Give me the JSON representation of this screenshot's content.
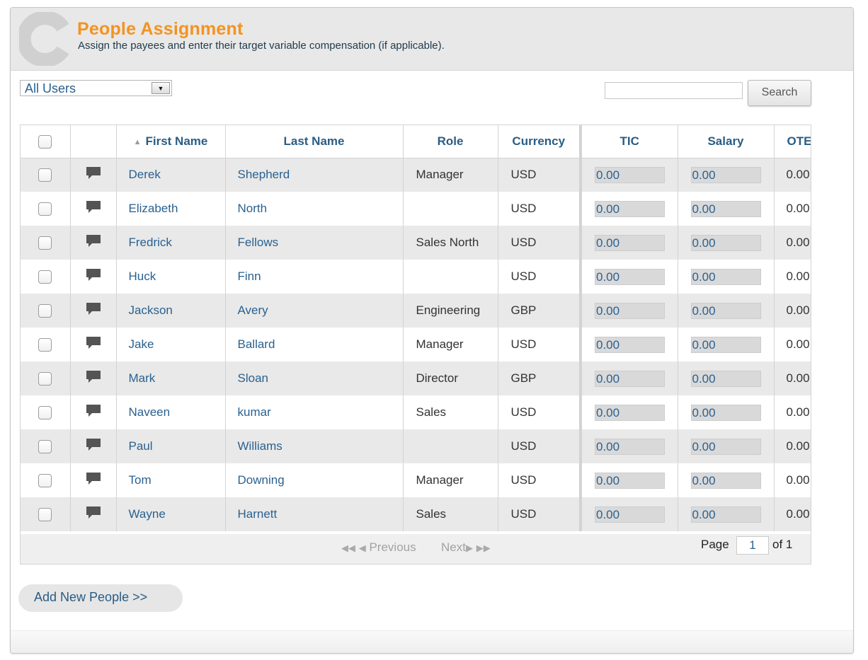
{
  "header": {
    "title": "People Assignment",
    "subtitle": "Assign the payees and enter their target variable compensation (if applicable)."
  },
  "filter": {
    "selected": "All Users"
  },
  "search": {
    "button_label": "Search",
    "value": ""
  },
  "table": {
    "columns": {
      "first_name": "First Name",
      "last_name": "Last Name",
      "role": "Role",
      "currency": "Currency",
      "tic": "TIC",
      "salary": "Salary",
      "ote": "OTE"
    },
    "rows": [
      {
        "first": "Derek",
        "last": "Shepherd",
        "role": "Manager",
        "currency": "USD",
        "tic": "0.00",
        "salary": "0.00",
        "ote": "0.00"
      },
      {
        "first": "Elizabeth",
        "last": "North",
        "role": "",
        "currency": "USD",
        "tic": "0.00",
        "salary": "0.00",
        "ote": "0.00"
      },
      {
        "first": "Fredrick",
        "last": "Fellows",
        "role": "Sales North",
        "currency": "USD",
        "tic": "0.00",
        "salary": "0.00",
        "ote": "0.00"
      },
      {
        "first": "Huck",
        "last": "Finn",
        "role": "",
        "currency": "USD",
        "tic": "0.00",
        "salary": "0.00",
        "ote": "0.00"
      },
      {
        "first": "Jackson",
        "last": "Avery",
        "role": "Engineering",
        "currency": "GBP",
        "tic": "0.00",
        "salary": "0.00",
        "ote": "0.00"
      },
      {
        "first": "Jake",
        "last": "Ballard",
        "role": "Manager",
        "currency": "USD",
        "tic": "0.00",
        "salary": "0.00",
        "ote": "0.00"
      },
      {
        "first": "Mark",
        "last": "Sloan",
        "role": "Director",
        "currency": "GBP",
        "tic": "0.00",
        "salary": "0.00",
        "ote": "0.00"
      },
      {
        "first": "Naveen",
        "last": "kumar",
        "role": "Sales",
        "currency": "USD",
        "tic": "0.00",
        "salary": "0.00",
        "ote": "0.00"
      },
      {
        "first": "Paul",
        "last": "Williams",
        "role": "",
        "currency": "USD",
        "tic": "0.00",
        "salary": "0.00",
        "ote": "0.00"
      },
      {
        "first": "Tom",
        "last": "Downing",
        "role": "Manager",
        "currency": "USD",
        "tic": "0.00",
        "salary": "0.00",
        "ote": "0.00"
      },
      {
        "first": "Wayne",
        "last": "Harnett",
        "role": "Sales",
        "currency": "USD",
        "tic": "0.00",
        "salary": "0.00",
        "ote": "0.00"
      }
    ]
  },
  "pager": {
    "previous": "Previous",
    "next": "Next",
    "page_label": "Page",
    "page_value": "1",
    "of_label": "of 1"
  },
  "actions": {
    "add_people": "Add New People >>"
  },
  "icons": {
    "logo": "c-logo-icon",
    "row_note": "speech-bubble-icon",
    "sort": "sort-ascending-icon",
    "dropdown": "chevron-down-icon",
    "first_page": "double-left-arrow-icon",
    "prev_page": "left-arrow-icon",
    "next_page": "right-arrow-icon",
    "last_page": "double-right-arrow-icon"
  },
  "colors": {
    "title": "#f39322",
    "link": "#2a6190",
    "row_alt": "#e9e9e9"
  }
}
